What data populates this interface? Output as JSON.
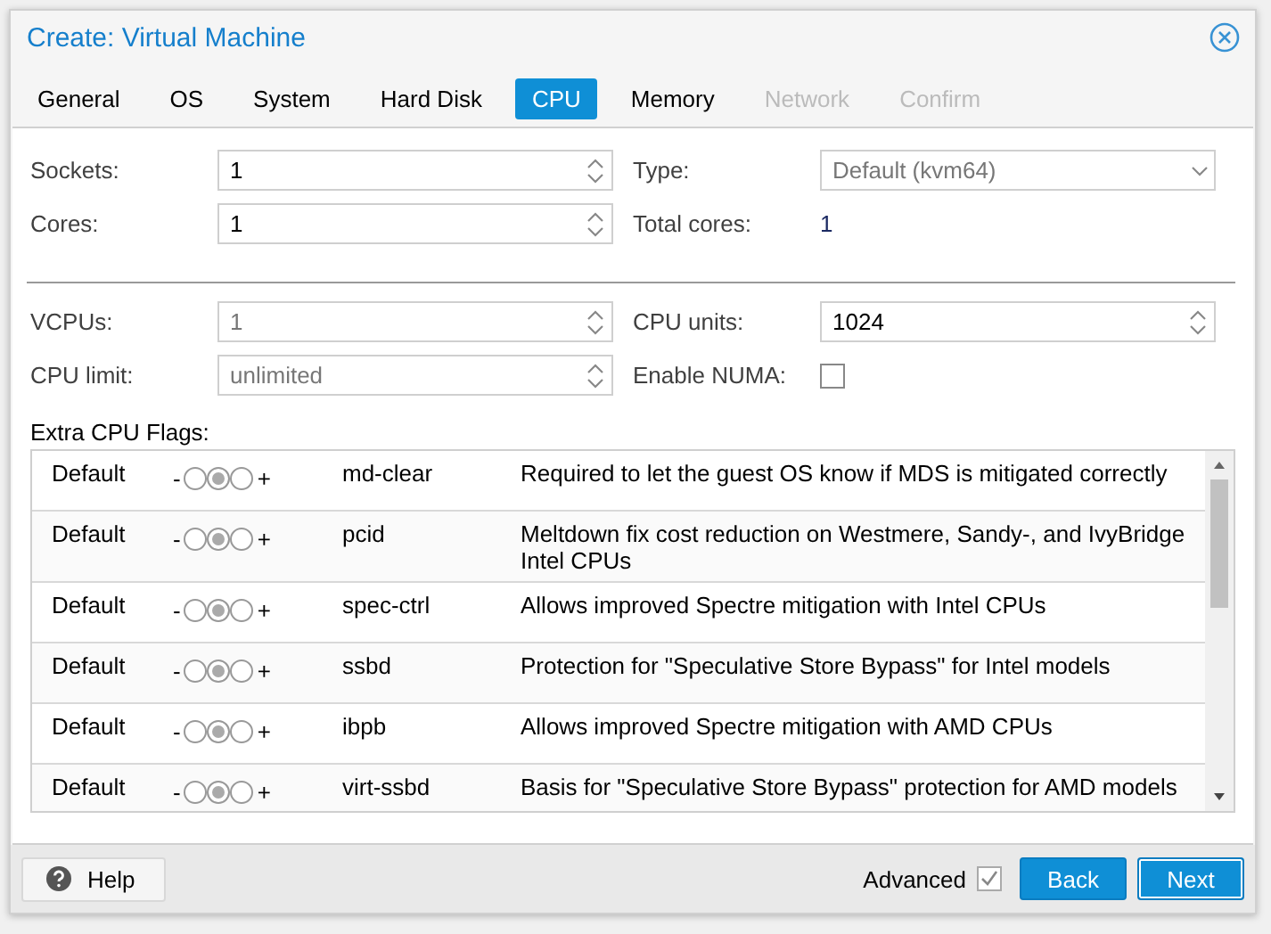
{
  "window": {
    "title": "Create: Virtual Machine"
  },
  "tabs": [
    {
      "label": "General",
      "selected": false,
      "disabled": false
    },
    {
      "label": "OS",
      "selected": false,
      "disabled": false
    },
    {
      "label": "System",
      "selected": false,
      "disabled": false
    },
    {
      "label": "Hard Disk",
      "selected": false,
      "disabled": false
    },
    {
      "label": "CPU",
      "selected": true,
      "disabled": false
    },
    {
      "label": "Memory",
      "selected": false,
      "disabled": false
    },
    {
      "label": "Network",
      "selected": false,
      "disabled": true
    },
    {
      "label": "Confirm",
      "selected": false,
      "disabled": true
    }
  ],
  "fields": [
    [
      {
        "label": "Sockets:",
        "kind": "spinner",
        "value": "1",
        "disabled": false
      },
      {
        "label": "Type:",
        "kind": "combo",
        "value": "Default (kvm64)",
        "disabled": true
      }
    ],
    [
      {
        "label": "Cores:",
        "kind": "spinner",
        "value": "1",
        "disabled": false
      },
      {
        "label": "Total cores:",
        "kind": "display",
        "value": "1"
      }
    ]
  ],
  "advanced_fields": [
    [
      {
        "label": "VCPUs:",
        "kind": "spinner",
        "value": "1",
        "disabled": true
      },
      {
        "label": "CPU units:",
        "kind": "spinner",
        "value": "1024",
        "disabled": false
      }
    ],
    [
      {
        "label": "CPU limit:",
        "kind": "spinner",
        "value": "unlimited",
        "disabled": true
      },
      {
        "label": "Enable NUMA:",
        "kind": "checkbox",
        "checked": false
      }
    ]
  ],
  "flags_label": "Extra CPU Flags:",
  "flags": [
    {
      "state": "Default",
      "minus": "-",
      "plus": "+",
      "radios": [
        {
          "selected": false
        },
        {
          "selected": true
        },
        {
          "selected": false
        }
      ],
      "flag": "md-clear",
      "description": "Required to let the guest OS know if MDS is mitigated correctly"
    },
    {
      "state": "Default",
      "minus": "-",
      "plus": "+",
      "radios": [
        {
          "selected": false
        },
        {
          "selected": true
        },
        {
          "selected": false
        }
      ],
      "flag": "pcid",
      "description": "Meltdown fix cost reduction on Westmere, Sandy-, and IvyBridge Intel CPUs"
    },
    {
      "state": "Default",
      "minus": "-",
      "plus": "+",
      "radios": [
        {
          "selected": false
        },
        {
          "selected": true
        },
        {
          "selected": false
        }
      ],
      "flag": "spec-ctrl",
      "description": "Allows improved Spectre mitigation with Intel CPUs"
    },
    {
      "state": "Default",
      "minus": "-",
      "plus": "+",
      "radios": [
        {
          "selected": false
        },
        {
          "selected": true
        },
        {
          "selected": false
        }
      ],
      "flag": "ssbd",
      "description": "Protection for \"Speculative Store Bypass\" for Intel models"
    },
    {
      "state": "Default",
      "minus": "-",
      "plus": "+",
      "radios": [
        {
          "selected": false
        },
        {
          "selected": true
        },
        {
          "selected": false
        }
      ],
      "flag": "ibpb",
      "description": "Allows improved Spectre mitigation with AMD CPUs"
    },
    {
      "state": "Default",
      "minus": "-",
      "plus": "+",
      "radios": [
        {
          "selected": false
        },
        {
          "selected": true
        },
        {
          "selected": false
        }
      ],
      "flag": "virt-ssbd",
      "description": "Basis for \"Speculative Store Bypass\" protection for AMD models"
    }
  ],
  "footer": {
    "help": "Help",
    "advanced": {
      "label": "Advanced",
      "checked": true
    },
    "buttons": [
      "Back",
      "Next"
    ]
  }
}
